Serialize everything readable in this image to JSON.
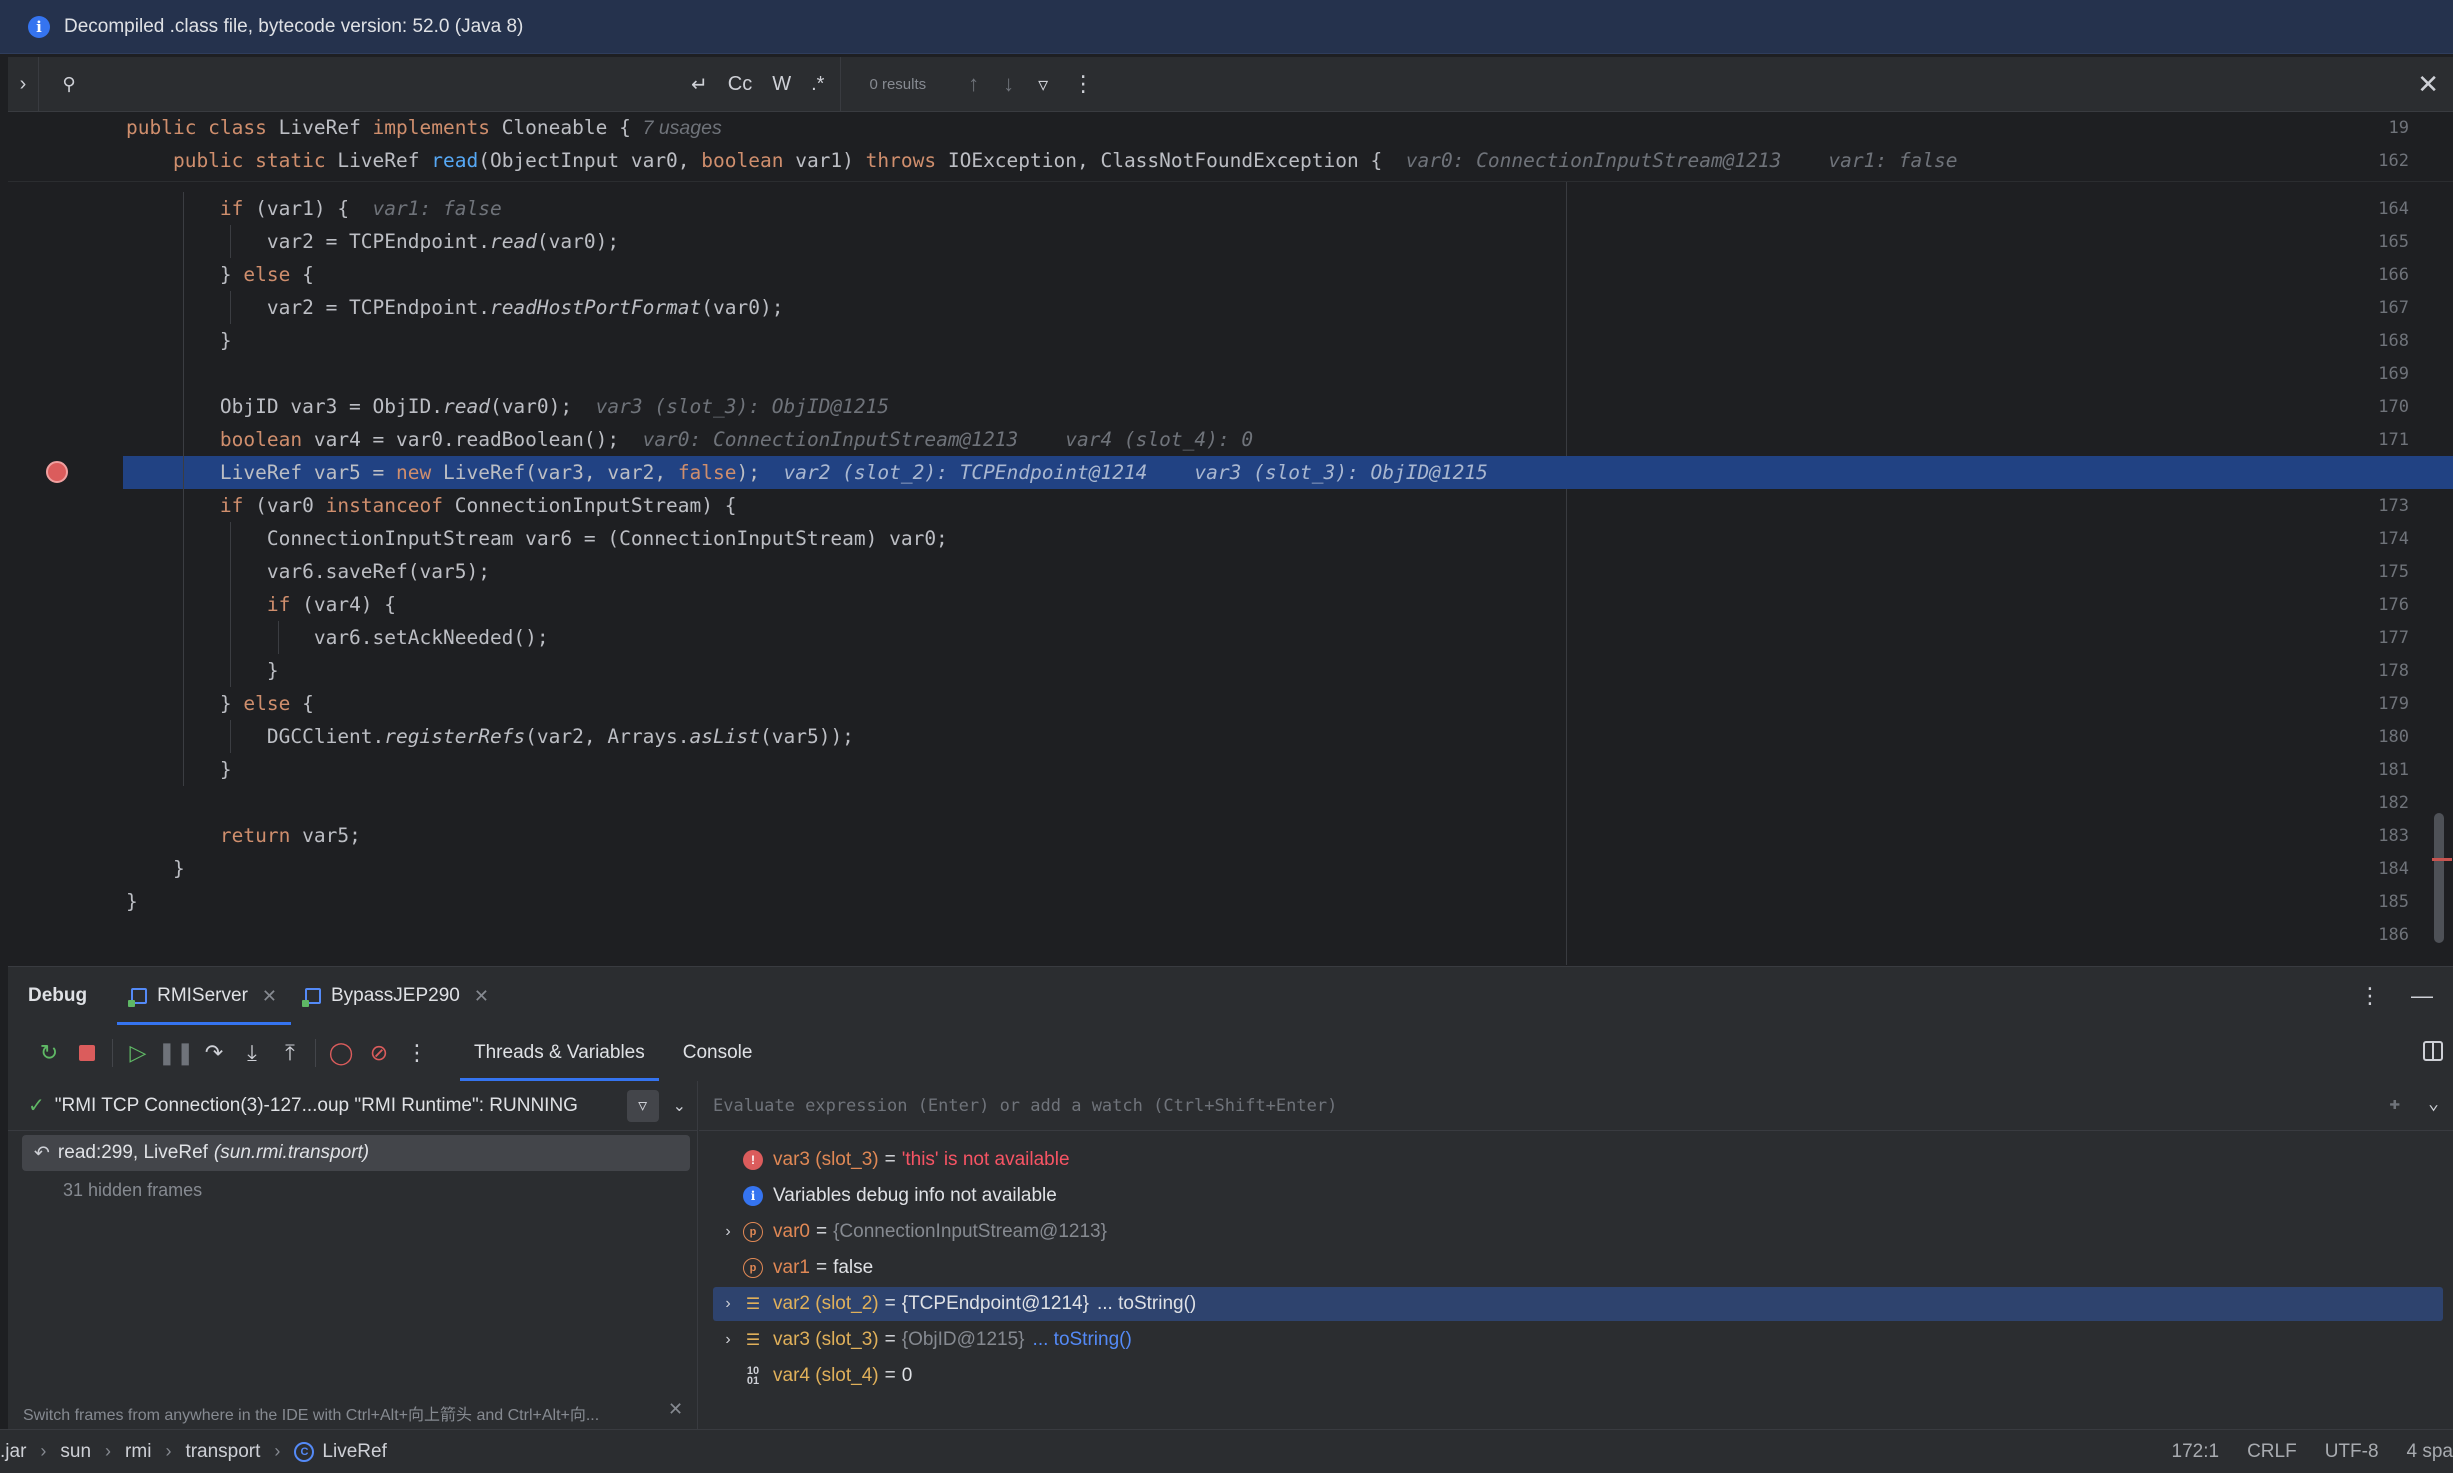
{
  "banner": {
    "text": "Decompiled .class file, bytecode version: 52.0 (Java 8)"
  },
  "search": {
    "results": "0 results",
    "case_label": "Cc",
    "word_label": "W",
    "regex_label": ".*"
  },
  "editor": {
    "sticky": [
      {
        "num": "19",
        "parts": [
          [
            "kw",
            "public class "
          ],
          [
            "id",
            "LiveRef "
          ],
          [
            "kw",
            "implements "
          ],
          [
            "id",
            "Cloneable { "
          ],
          [
            "hintsm",
            "7 usages"
          ]
        ]
      },
      {
        "num": "162",
        "parts": [
          [
            "kw",
            "    public static "
          ],
          [
            "id",
            "LiveRef "
          ],
          [
            "fn",
            "read"
          ],
          [
            "id",
            "(ObjectInput var0, "
          ],
          [
            "kw",
            "boolean "
          ],
          [
            "id",
            "var1) "
          ],
          [
            "kw",
            "throws "
          ],
          [
            "id",
            "IOException, ClassNotFoundException {  "
          ],
          [
            "hint",
            "var0: ConnectionInputStream@1213    var1: false"
          ]
        ]
      }
    ],
    "lines": [
      {
        "num": "164",
        "parts": [
          [
            "kw",
            "        if "
          ],
          [
            "id",
            "(var1) {  "
          ],
          [
            "hint",
            "var1: false"
          ]
        ]
      },
      {
        "num": "165",
        "parts": [
          [
            "id",
            "            var2 = TCPEndpoint."
          ],
          [
            "idit",
            "read"
          ],
          [
            "id",
            "(var0);"
          ]
        ]
      },
      {
        "num": "166",
        "parts": [
          [
            "id",
            "        } "
          ],
          [
            "kw",
            "else "
          ],
          [
            "id",
            "{"
          ]
        ]
      },
      {
        "num": "167",
        "parts": [
          [
            "id",
            "            var2 = TCPEndpoint."
          ],
          [
            "idit",
            "readHostPortFormat"
          ],
          [
            "id",
            "(var0);"
          ]
        ]
      },
      {
        "num": "168",
        "parts": [
          [
            "id",
            "        }"
          ]
        ]
      },
      {
        "num": "169",
        "parts": []
      },
      {
        "num": "170",
        "parts": [
          [
            "id",
            "        ObjID var3 = ObjID."
          ],
          [
            "idit",
            "read"
          ],
          [
            "id",
            "(var0);  "
          ],
          [
            "hint",
            "var3 (slot_3): ObjID@1215"
          ]
        ]
      },
      {
        "num": "171",
        "parts": [
          [
            "kw",
            "        boolean "
          ],
          [
            "id",
            "var4 = var0.readBoolean();  "
          ],
          [
            "hint",
            "var0: ConnectionInputStream@1213    var4 (slot_4): 0"
          ]
        ]
      },
      {
        "num": "",
        "parts": [
          [
            "id",
            "        LiveRef var5 = "
          ],
          [
            "kw",
            "new "
          ],
          [
            "id",
            "LiveRef(var3, var2, "
          ],
          [
            "kw",
            "false"
          ],
          [
            "id",
            ");  "
          ],
          [
            "hinthl",
            "var2 (slot_2): TCPEndpoint@1214    var3 (slot_3): ObjID@1215"
          ]
        ],
        "highlight": true
      },
      {
        "num": "173",
        "parts": [
          [
            "kw",
            "        if "
          ],
          [
            "id",
            "(var0 "
          ],
          [
            "kw",
            "instanceof "
          ],
          [
            "id",
            "ConnectionInputStream) {"
          ]
        ]
      },
      {
        "num": "174",
        "parts": [
          [
            "id",
            "            ConnectionInputStream var6 = (ConnectionInputStream) var0;"
          ]
        ]
      },
      {
        "num": "175",
        "parts": [
          [
            "id",
            "            var6.saveRef(var5);"
          ]
        ]
      },
      {
        "num": "176",
        "parts": [
          [
            "kw",
            "            if "
          ],
          [
            "id",
            "(var4) {"
          ]
        ]
      },
      {
        "num": "177",
        "parts": [
          [
            "id",
            "                var6.setAckNeeded();"
          ]
        ]
      },
      {
        "num": "178",
        "parts": [
          [
            "id",
            "            }"
          ]
        ]
      },
      {
        "num": "179",
        "parts": [
          [
            "id",
            "        } "
          ],
          [
            "kw",
            "else "
          ],
          [
            "id",
            "{"
          ]
        ]
      },
      {
        "num": "180",
        "parts": [
          [
            "id",
            "            DGCClient."
          ],
          [
            "idit",
            "registerRefs"
          ],
          [
            "id",
            "(var2, Arrays."
          ],
          [
            "idit",
            "asList"
          ],
          [
            "id",
            "(var5));"
          ]
        ]
      },
      {
        "num": "181",
        "parts": [
          [
            "id",
            "        }"
          ]
        ]
      },
      {
        "num": "182",
        "parts": []
      },
      {
        "num": "183",
        "parts": [
          [
            "kw",
            "        return "
          ],
          [
            "id",
            "var5;"
          ]
        ]
      },
      {
        "num": "184",
        "parts": [
          [
            "id",
            "    }"
          ]
        ]
      },
      {
        "num": "185",
        "parts": [
          [
            "id",
            "}"
          ]
        ]
      },
      {
        "num": "186",
        "parts": []
      }
    ]
  },
  "debug": {
    "title": "Debug",
    "tabs": [
      {
        "label": "RMIServer",
        "active": true
      },
      {
        "label": "BypassJEP290",
        "active": false
      }
    ],
    "subtabs": [
      "Threads & Variables",
      "Console"
    ],
    "thread": "\"RMI TCP Connection(3)-127...oup \"RMI Runtime\": RUNNING",
    "frame": {
      "method": "read:299, LiveRef",
      "package": "(sun.rmi.transport)"
    },
    "hidden_frames": "31 hidden frames",
    "tip": "Switch frames from anywhere in the IDE with Ctrl+Alt+向上箭头 and Ctrl+Alt+向...",
    "eval_placeholder": "Evaluate expression (Enter) or add a watch (Ctrl+Shift+Enter)",
    "variables": [
      {
        "icon": "error",
        "name": "var3 (slot_3)",
        "eq": "=",
        "value": "'this' is not available",
        "valueStyle": "red",
        "expand": false
      },
      {
        "icon": "info",
        "name": "",
        "eq": "",
        "value": "Variables debug info not available",
        "valueStyle": "white",
        "expand": false
      },
      {
        "icon": "param",
        "name": "var0",
        "eq": "=",
        "value": "{ConnectionInputStream@1213}",
        "valueStyle": "gray",
        "expand": true
      },
      {
        "icon": "param",
        "name": "var1",
        "eq": "=",
        "value": "false",
        "valueStyle": "white",
        "expand": false
      },
      {
        "icon": "local",
        "name": "var2 (slot_2)",
        "eq": "=",
        "value": "{TCPEndpoint@1214}",
        "valueStyle": "white",
        "link": "... toString()",
        "expand": true,
        "selected": true
      },
      {
        "icon": "local",
        "name": "var3 (slot_3)",
        "eq": "=",
        "value": "{ObjID@1215}",
        "valueStyle": "gray",
        "link": "... toString()",
        "expand": true
      },
      {
        "icon": "prim",
        "name": "var4 (slot_4)",
        "eq": "=",
        "value": "0",
        "valueStyle": "white",
        "expand": false
      }
    ]
  },
  "statusbar": {
    "crumbs": [
      ".jar",
      "sun",
      "rmi",
      "transport",
      "LiveRef"
    ],
    "position": "172:1",
    "line_sep": "CRLF",
    "encoding": "UTF-8",
    "indent": "4 spa"
  }
}
